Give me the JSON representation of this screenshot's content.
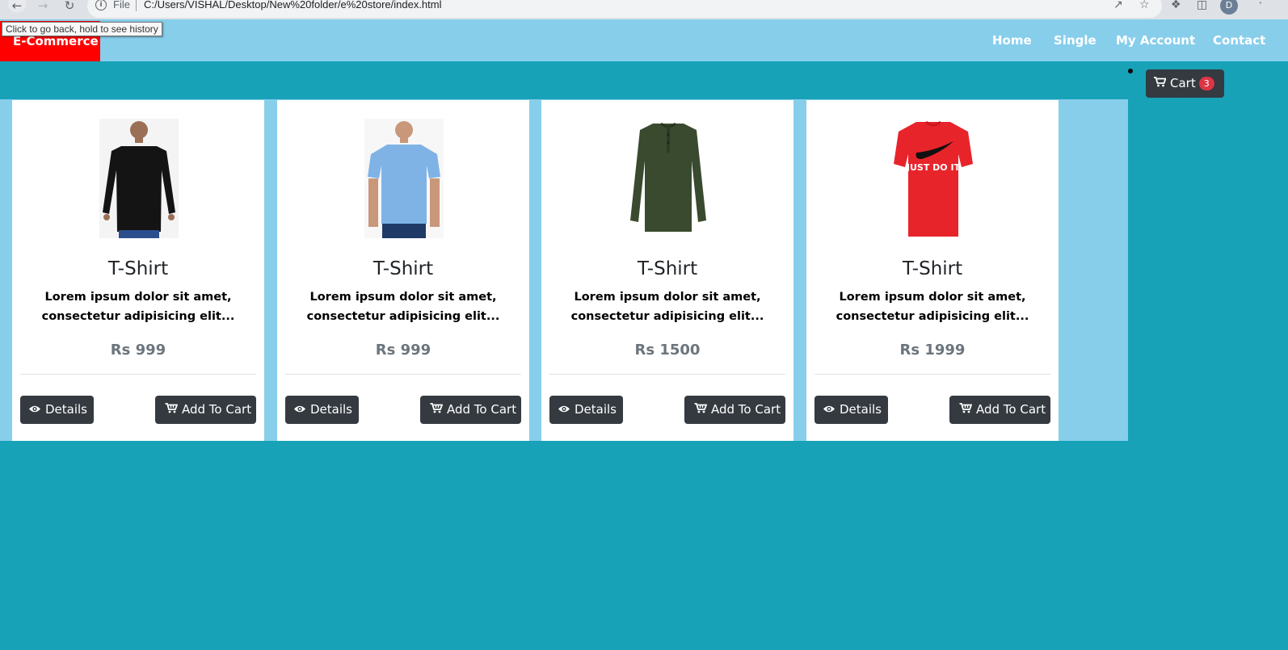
{
  "browser": {
    "back_icon": "arrow-left-icon",
    "omnibox_label": "File",
    "url": "C:/Users/VISHAL/Desktop/New%20folder/e%20store/index.html",
    "profile_initial": "D",
    "tooltip": "Click to go back, hold to see history"
  },
  "site": {
    "brand": "E-Commerce",
    "brand_color": "#ff0000",
    "nav_color": "#87ceeb",
    "page_color": "#17a2b8",
    "menu": [
      "Home",
      "Single",
      "My Account",
      "Contact"
    ],
    "cart": {
      "label": "Cart",
      "count": "3"
    }
  },
  "products": [
    {
      "title": "T-Shirt",
      "desc_line1": "Lorem ipsum dolor sit amet,",
      "desc_line2": "consectetur adipisicing elit...",
      "price": "Rs 999",
      "details_label": "Details",
      "cart_label": "Add To Cart",
      "image": "black-longsleeve-tshirt"
    },
    {
      "title": "T-Shirt",
      "desc_line1": "Lorem ipsum dolor sit amet,",
      "desc_line2": "consectetur adipisicing elit...",
      "price": "Rs 999",
      "details_label": "Details",
      "cart_label": "Add To Cart",
      "image": "light-blue-tshirt"
    },
    {
      "title": "T-Shirt",
      "desc_line1": "Lorem ipsum dolor sit amet,",
      "desc_line2": "consectetur adipisicing elit...",
      "price": "Rs 1500",
      "details_label": "Details",
      "cart_label": "Add To Cart",
      "image": "olive-henley-tshirt"
    },
    {
      "title": "T-Shirt",
      "desc_line1": "Lorem ipsum dolor sit amet,",
      "desc_line2": "consectetur adipisicing elit...",
      "price": "Rs 1999",
      "details_label": "Details",
      "cart_label": "Add To Cart",
      "image": "red-just-do-it-tshirt",
      "image_text": "JUST DO IT"
    }
  ]
}
